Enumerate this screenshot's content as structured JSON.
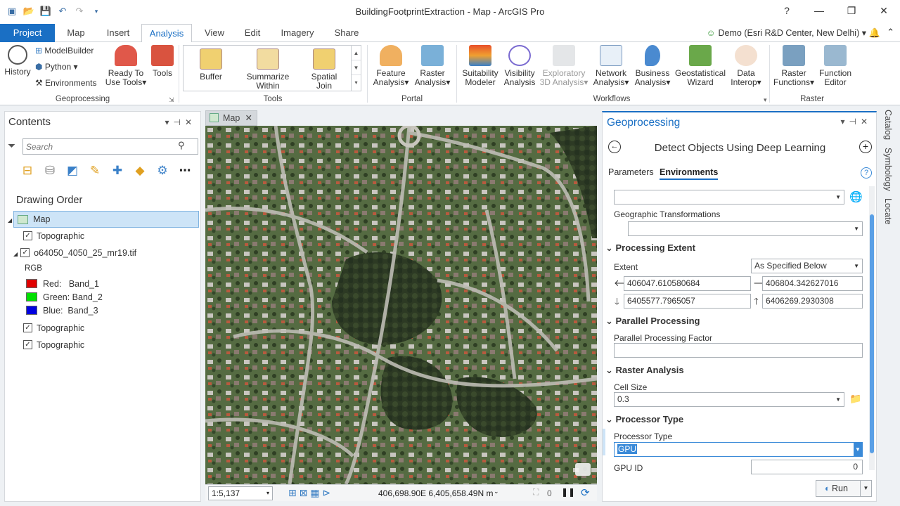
{
  "app_title": "BuildingFootprintExtraction - Map - ArcGIS Pro",
  "window_controls": {
    "help": "?",
    "minimize": "—",
    "restore": "❐",
    "close": "✕"
  },
  "user": "Demo (Esri R&D Center, New Delhi)",
  "tabs": [
    "Project",
    "Map",
    "Insert",
    "Analysis",
    "View",
    "Edit",
    "Imagery",
    "Share"
  ],
  "active_tab": "Analysis",
  "ribbon": {
    "geoprocessing": {
      "label": "Geoprocessing",
      "history": "History",
      "modelbuilder": "ModelBuilder",
      "python": "Python",
      "environments": "Environments",
      "ready_to_use_1": "Ready To",
      "ready_to_use_2": "Use Tools",
      "tools": "Tools"
    },
    "tools": {
      "label": "Tools",
      "buffer": "Buffer",
      "summarize_1": "Summarize",
      "summarize_2": "Within",
      "spatial_1": "Spatial",
      "spatial_2": "Join"
    },
    "portal": {
      "label": "Portal",
      "feature_1": "Feature",
      "feature_2": "Analysis",
      "raster_1": "Raster",
      "raster_2": "Analysis"
    },
    "workflows": {
      "label": "Workflows",
      "suitability_1": "Suitability",
      "suitability_2": "Modeler",
      "visibility_1": "Visibility",
      "visibility_2": "Analysis",
      "exploratory_1": "Exploratory",
      "exploratory_2": "3D Analysis",
      "network_1": "Network",
      "network_2": "Analysis",
      "business_1": "Business",
      "business_2": "Analysis",
      "geostat_1": "Geostatistical",
      "geostat_2": "Wizard",
      "datainterop_1": "Data",
      "datainterop_2": "Interop"
    },
    "raster": {
      "label": "Raster",
      "rasterfn_1": "Raster",
      "rasterfn_2": "Functions",
      "fneditor_1": "Function",
      "fneditor_2": "Editor"
    }
  },
  "contents": {
    "title": "Contents",
    "search_placeholder": "Search",
    "drawing_order": "Drawing Order",
    "map": "Map",
    "layers": {
      "topo1": "Topographic",
      "tif": "o64050_4050_25_mr19.tif",
      "rgb": "RGB",
      "red": "Red:   Band_1",
      "green": "Green: Band_2",
      "blue": "Blue:  Band_3",
      "topo2": "Topographic",
      "topo3": "Topographic"
    },
    "colors": {
      "red": "#e00000",
      "green": "#00e000",
      "blue": "#0000e0"
    }
  },
  "map_tab": "Map",
  "map_status": {
    "scale": "1:5,137",
    "coords": "406,698.90E 6,405,658.49N m",
    "selected_count": "0"
  },
  "geoprocessing": {
    "title": "Geoprocessing",
    "tool": "Detect Objects Using Deep Learning",
    "tab_parameters": "Parameters",
    "tab_environments": "Environments",
    "geographic_transformations": "Geographic Transformations",
    "processing_extent": "Processing Extent",
    "extent_label": "Extent",
    "extent_value": "As Specified Below",
    "left": "406047.610580684",
    "right": "406804.342627016",
    "bottom": "6405577.7965057",
    "top": "6406269.2930308",
    "parallel_processing": "Parallel Processing",
    "parallel_factor_label": "Parallel Processing Factor",
    "parallel_factor_value": "",
    "raster_analysis": "Raster Analysis",
    "cell_size_label": "Cell Size",
    "cell_size_value": "0.3",
    "processor_type_section": "Processor Type",
    "processor_type_label": "Processor Type",
    "processor_type_value": "GPU",
    "gpu_id_label": "GPU ID",
    "gpu_id_value": "0",
    "run": "Run"
  },
  "side_tabs": [
    "Catalog",
    "Symbology",
    "Locate"
  ]
}
